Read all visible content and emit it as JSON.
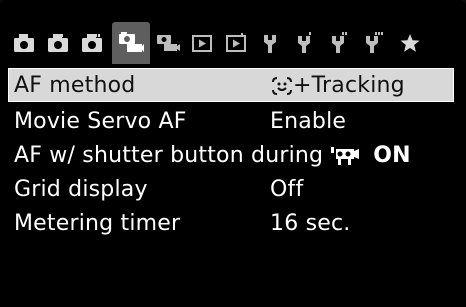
{
  "tabs": [
    {
      "name": "shooting-1-tab-icon",
      "type": "camera"
    },
    {
      "name": "shooting-2-tab-icon",
      "type": "camera"
    },
    {
      "name": "shooting-3-tab-icon",
      "type": "camera"
    },
    {
      "name": "movie-shooting-1-tab-icon",
      "type": "movie",
      "active": true
    },
    {
      "name": "movie-shooting-2-tab-icon",
      "type": "movie"
    },
    {
      "name": "playback-1-tab-icon",
      "type": "play"
    },
    {
      "name": "playback-2-tab-icon",
      "type": "play"
    },
    {
      "name": "setup-1-tab-icon",
      "type": "wrench"
    },
    {
      "name": "setup-2-tab-icon",
      "type": "wrench"
    },
    {
      "name": "setup-3-tab-icon",
      "type": "wrench"
    },
    {
      "name": "setup-4-tab-icon",
      "type": "wrench"
    },
    {
      "name": "my-menu-tab-icon",
      "type": "star"
    }
  ],
  "menu": {
    "items": [
      {
        "label": "AF method",
        "value": "+Tracking",
        "value_icon": "face-detect-icon",
        "selected": true
      },
      {
        "label": "Movie Servo AF",
        "value": "Enable"
      },
      {
        "label": "AF w/ shutter button during",
        "value": "ON",
        "value_icon": "movie-icon"
      },
      {
        "label": "Grid display",
        "value": "Off"
      },
      {
        "label": "Metering timer",
        "value": "16 sec."
      }
    ]
  },
  "colors": {
    "background": "#000000",
    "active_tab": "#5e5e5e",
    "selection": "#d8d8d8",
    "text": "#ffffff"
  }
}
